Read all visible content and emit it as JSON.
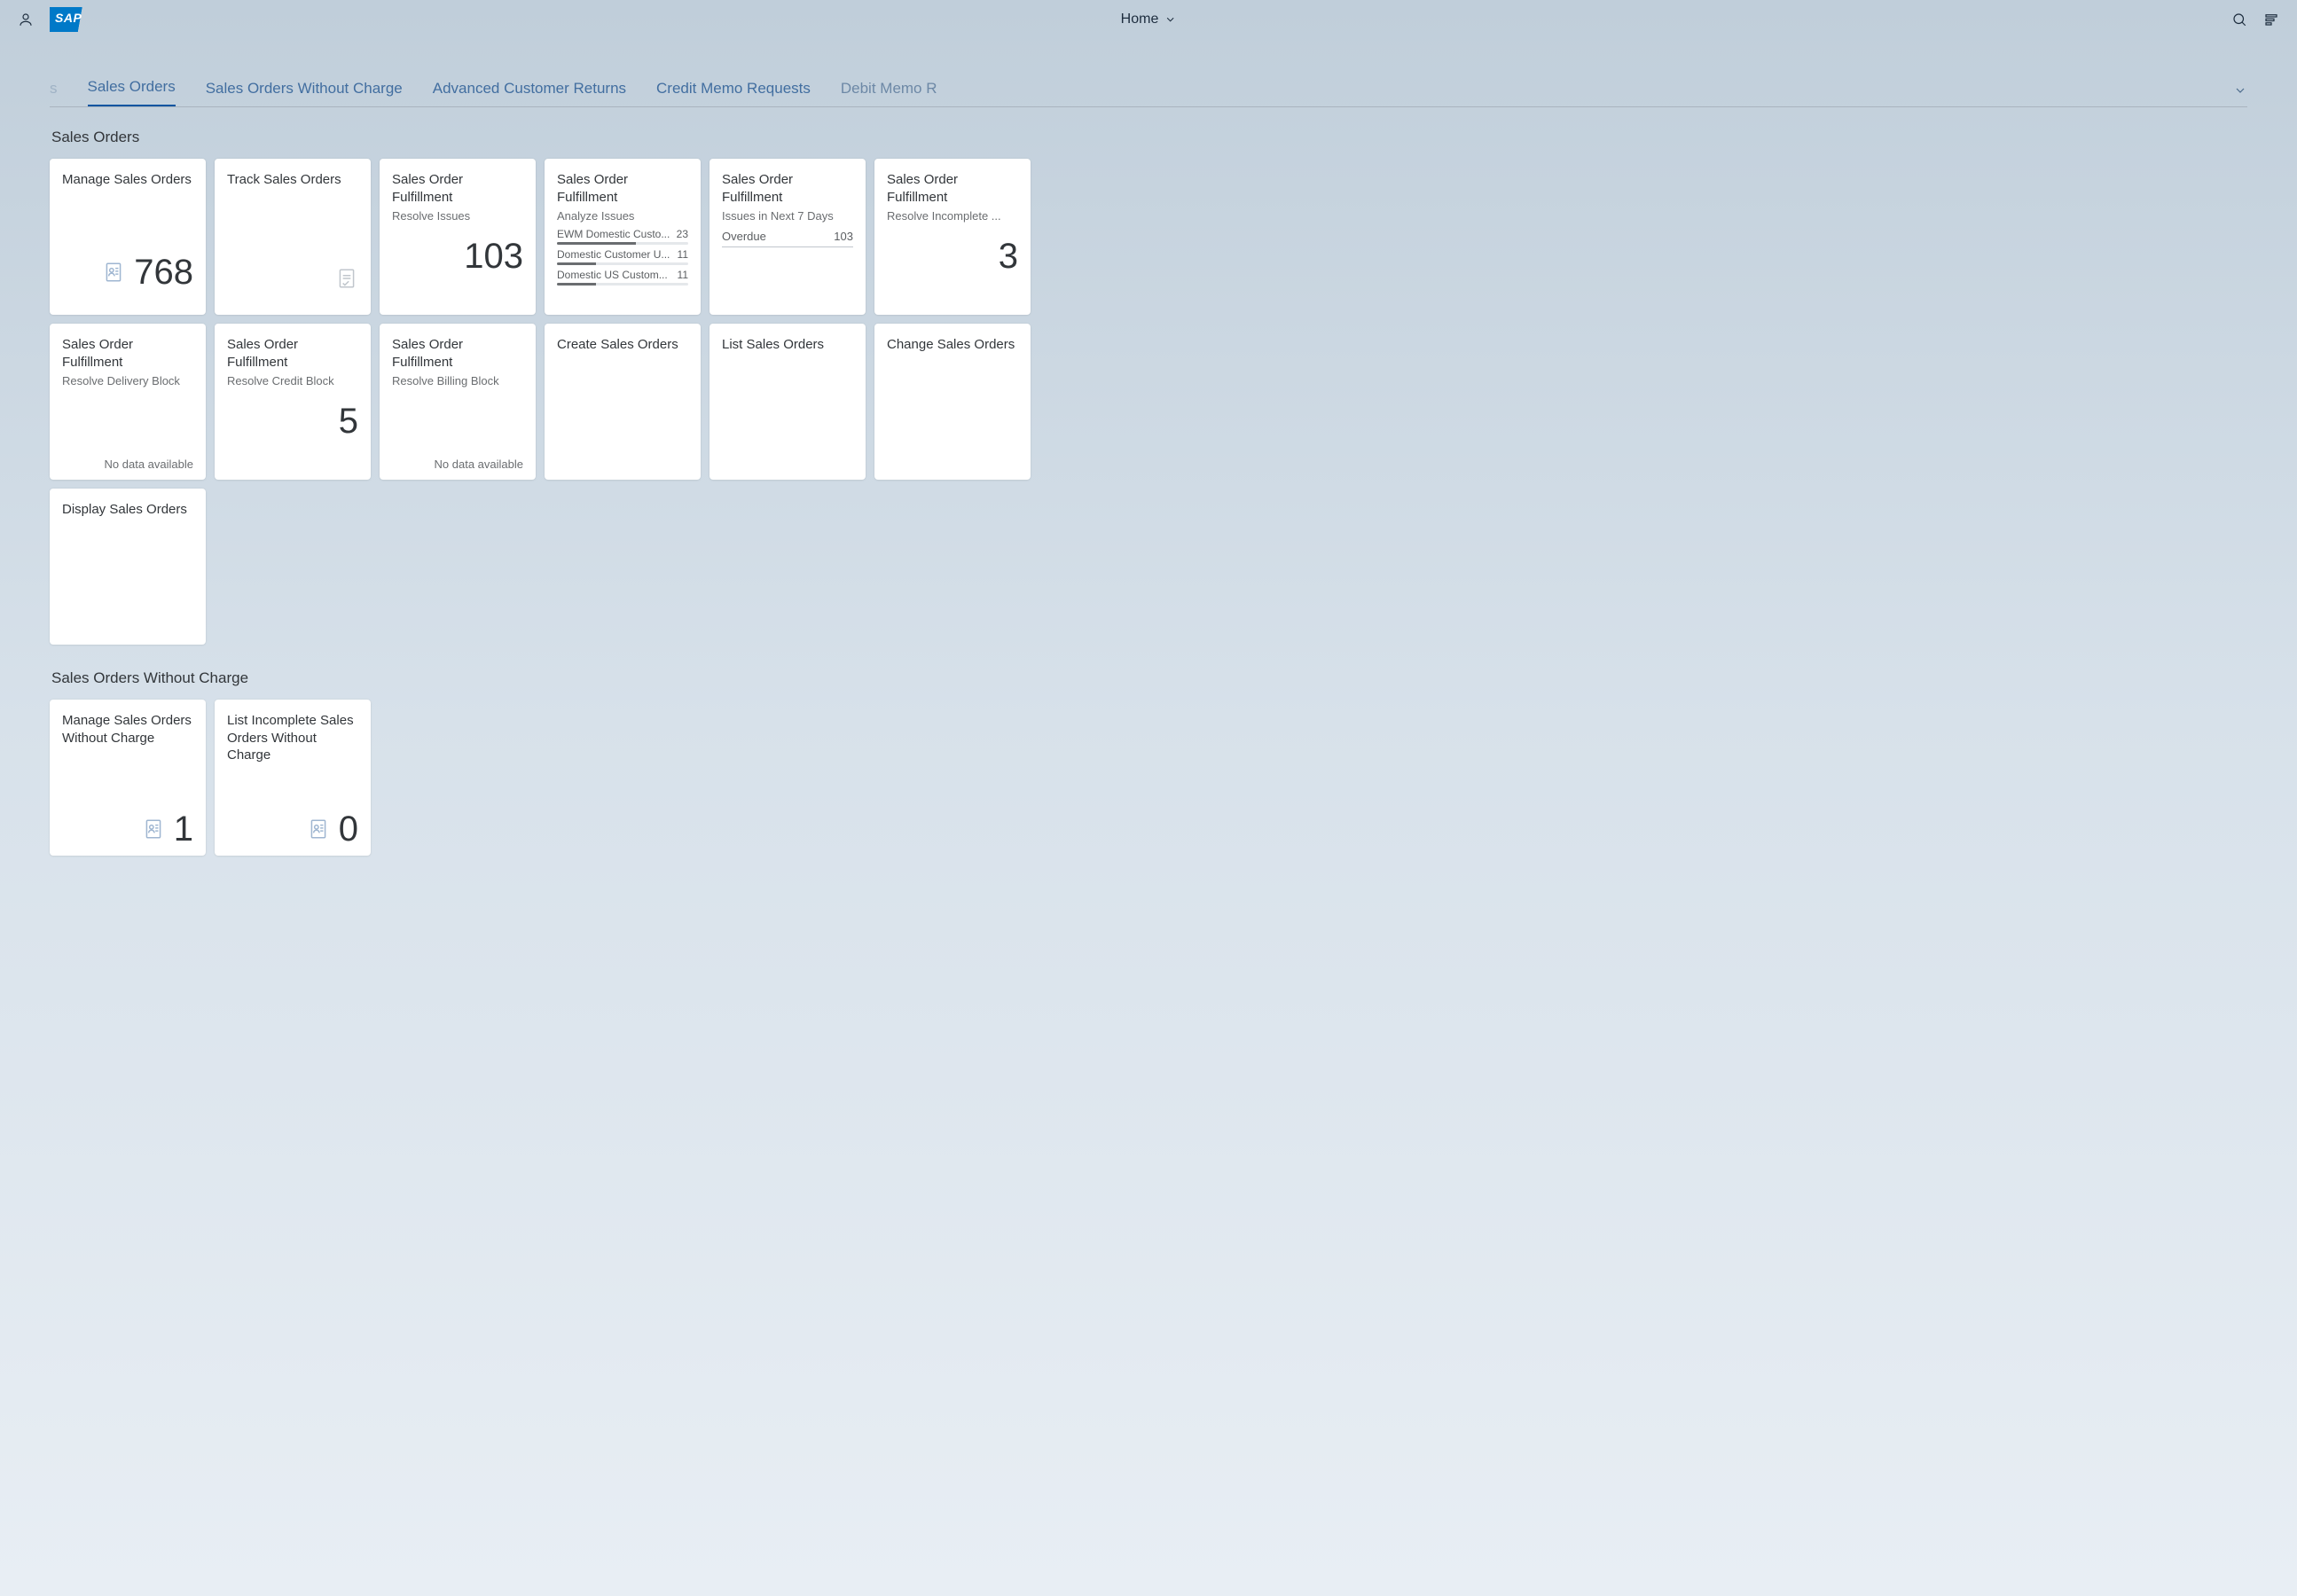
{
  "header": {
    "title": "Home"
  },
  "tabs": {
    "partial_left": "s",
    "items": [
      "Sales Orders",
      "Sales Orders Without Charge",
      "Advanced Customer Returns",
      "Credit Memo Requests",
      "Debit Memo R"
    ],
    "active_index": 0
  },
  "sections": [
    {
      "title": "Sales Orders",
      "tiles": [
        {
          "type": "kpi",
          "title": "Manage Sales Orders",
          "value": "768",
          "icon": "doc-person"
        },
        {
          "type": "icon-only",
          "title": "Track Sales Orders",
          "icon": "doc-check"
        },
        {
          "type": "kpi-nolabel",
          "title": "Sales Order Fulfillment",
          "subtitle": "Resolve Issues",
          "value": "103"
        },
        {
          "type": "mini-list",
          "title": "Sales Order Fulfillment",
          "subtitle": "Analyze Issues",
          "rows": [
            {
              "label": "EWM Domestic Custo...",
              "value": "23",
              "pct": 60
            },
            {
              "label": "Domestic Customer U...",
              "value": "11",
              "pct": 30
            },
            {
              "label": "Domestic US Custom...",
              "value": "11",
              "pct": 30
            }
          ]
        },
        {
          "type": "overdue",
          "title": "Sales Order Fulfillment",
          "subtitle": "Issues in Next 7 Days",
          "metric_label": "Overdue",
          "metric_value": "103"
        },
        {
          "type": "kpi-right",
          "title": "Sales Order Fulfillment",
          "subtitle": "Resolve Incomplete ...",
          "value": "3"
        },
        {
          "type": "footer-msg",
          "title": "Sales Order Fulfillment",
          "subtitle": "Resolve Delivery Block",
          "msg": "No data available"
        },
        {
          "type": "kpi-right",
          "title": "Sales Order Fulfillment",
          "subtitle": "Resolve Credit Block",
          "value": "5"
        },
        {
          "type": "footer-msg",
          "title": "Sales Order Fulfillment",
          "subtitle": "Resolve Billing Block",
          "msg": "No data available"
        },
        {
          "type": "plain",
          "title": "Create Sales Orders"
        },
        {
          "type": "plain",
          "title": "List Sales Orders"
        },
        {
          "type": "plain",
          "title": "Change Sales Orders"
        },
        {
          "type": "plain",
          "title": "Display Sales Orders"
        }
      ]
    },
    {
      "title": "Sales Orders Without Charge",
      "tiles": [
        {
          "type": "kpi",
          "title": "Manage Sales Orders Without Charge",
          "value": "1",
          "icon": "doc-person"
        },
        {
          "type": "kpi",
          "title": "List Incomplete Sales Orders Without Charge",
          "value": "0",
          "icon": "doc-person"
        }
      ]
    }
  ]
}
